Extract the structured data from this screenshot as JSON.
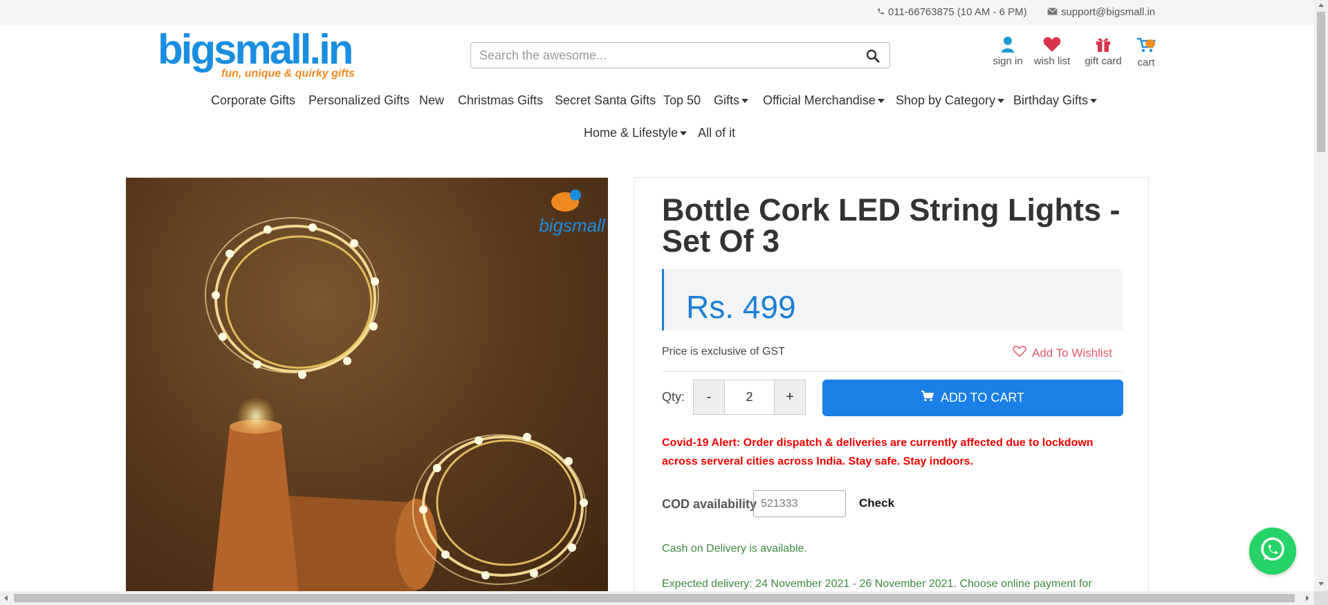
{
  "topbar": {
    "phone": "011-66763875 (10 AM - 6 PM)",
    "email": "support@bigsmall.in"
  },
  "logo": {
    "name": "bigsmall.in",
    "tagline": "fun, unique & quirky gifts"
  },
  "search": {
    "placeholder": "Search the awesome..."
  },
  "header_icons": {
    "sign_in": "sign in",
    "wish_list": "wish list",
    "gift_card": "gift card",
    "cart": "cart"
  },
  "nav": {
    "row1": [
      {
        "label": "Corporate Gifts"
      },
      {
        "label": "Personalized Gifts"
      },
      {
        "label": "New"
      },
      {
        "label": "Christmas Gifts"
      },
      {
        "label": "Secret Santa Gifts"
      },
      {
        "label": "Top 50"
      },
      {
        "label": "Gifts"
      },
      {
        "label": "Official Merchandise"
      },
      {
        "label": "Shop by Category"
      },
      {
        "label": "Birthday Gifts"
      }
    ],
    "row2": [
      {
        "label": "Home & Lifestyle"
      },
      {
        "label": "All of it"
      }
    ]
  },
  "product": {
    "image_logo_text": "bigsmall",
    "title": "Bottle Cork LED String Lights - Set Of 3",
    "price": "Rs. 499",
    "gst_note": "Price is exclusive of GST",
    "wishlist_label": "Add To Wishlist",
    "qty_label": "Qty:",
    "qty_minus": "-",
    "qty_value": "2",
    "qty_plus": "+",
    "add_to_cart": "ADD TO CART",
    "alert": "Covid-19 Alert: Order dispatch & deliveries are currently affected due to lockdown across serveral cities across India. Stay safe. Stay indoors.",
    "cod_label": "COD availability",
    "cod_pincode": "521333",
    "check_label": "Check",
    "cod_status": "Cash on Delivery is available.",
    "expected_delivery": "Expected delivery: 24 November 2021 - 26 November 2021. Choose online payment for"
  },
  "colors": {
    "brand_blue": "#1a8ee0",
    "brand_orange": "#f08a1e",
    "price_blue": "#1a7fd6",
    "cart_button": "#1a7fe6",
    "alert_red": "#ee0000",
    "success_green": "#3b8a3e",
    "whatsapp_green": "#25d366"
  },
  "icons": {
    "phone": "phone-icon",
    "email": "envelope-icon",
    "search": "search-icon",
    "sign_in": "user-icon",
    "wish_list": "heart-icon",
    "gift_card": "gift-icon",
    "cart": "cart-icon",
    "whatsapp": "whatsapp-icon"
  }
}
